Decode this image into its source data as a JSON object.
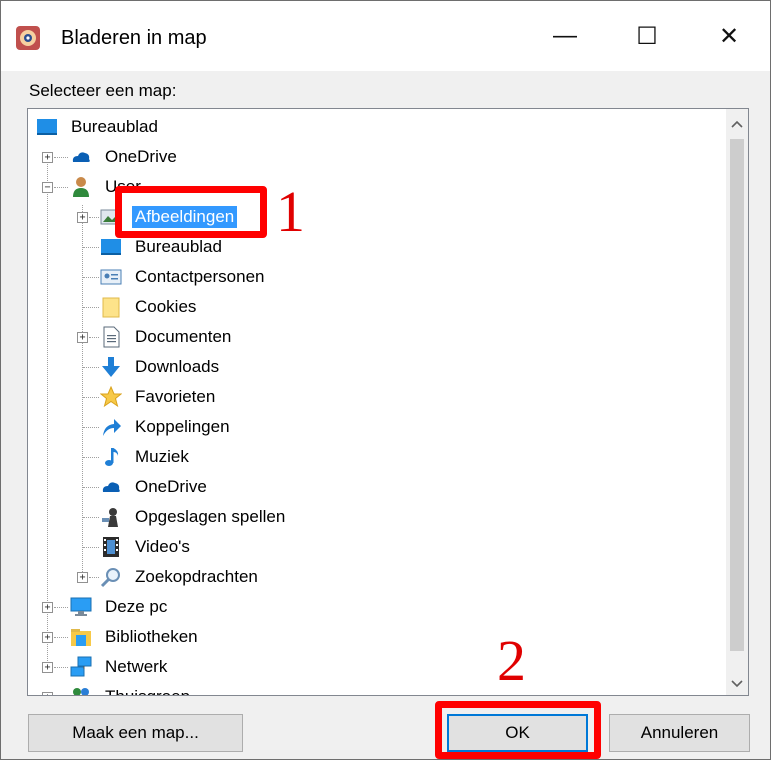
{
  "window": {
    "title": "Bladeren in map",
    "minimize": "—",
    "maximize": "☐",
    "close": "✕"
  },
  "prompt": "Selecteer een map:",
  "tree": {
    "items": [
      {
        "label": "Bureaublad"
      },
      {
        "label": "OneDrive"
      },
      {
        "label": "User"
      },
      {
        "label": "Afbeeldingen",
        "selected": true
      },
      {
        "label": "Bureaublad"
      },
      {
        "label": "Contactpersonen"
      },
      {
        "label": "Cookies"
      },
      {
        "label": "Documenten"
      },
      {
        "label": "Downloads"
      },
      {
        "label": "Favorieten"
      },
      {
        "label": "Koppelingen"
      },
      {
        "label": "Muziek"
      },
      {
        "label": "OneDrive"
      },
      {
        "label": "Opgeslagen spellen"
      },
      {
        "label": "Video's"
      },
      {
        "label": "Zoekopdrachten"
      },
      {
        "label": "Deze pc"
      },
      {
        "label": "Bibliotheken"
      },
      {
        "label": "Netwerk"
      },
      {
        "label": "Thuisgroep"
      }
    ]
  },
  "buttons": {
    "new_folder": "Maak een map...",
    "ok": "OK",
    "cancel": "Annuleren"
  },
  "annotations": {
    "marker1": "1",
    "marker2": "2"
  },
  "colors": {
    "selection": "#3399ff",
    "highlight": "#ff0000",
    "ok_border": "#0078d7"
  }
}
